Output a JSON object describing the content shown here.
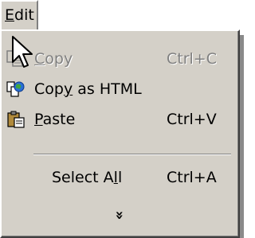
{
  "menubar": {
    "edit": {
      "mnemonic": "E",
      "rest": "dit"
    }
  },
  "menu": {
    "items": [
      {
        "pre": "",
        "mnemonic": "C",
        "post": "opy",
        "accel": "Ctrl+C",
        "icon": "copy-icon",
        "disabled": true
      },
      {
        "pre": "Cop",
        "mnemonic": "y",
        "post": " as HTML",
        "accel": "",
        "icon": "copy-as-html-icon",
        "disabled": false
      },
      {
        "pre": "",
        "mnemonic": "P",
        "post": "aste",
        "accel": "Ctrl+V",
        "icon": "paste-icon",
        "disabled": false
      },
      {
        "pre": "Select A",
        "mnemonic": "l",
        "post": "l",
        "accel": "Ctrl+A",
        "icon": "",
        "disabled": false
      }
    ],
    "expand_glyph": "»"
  },
  "colors": {
    "menu_bg": "#d4d0c8",
    "disabled_text": "#808080"
  }
}
